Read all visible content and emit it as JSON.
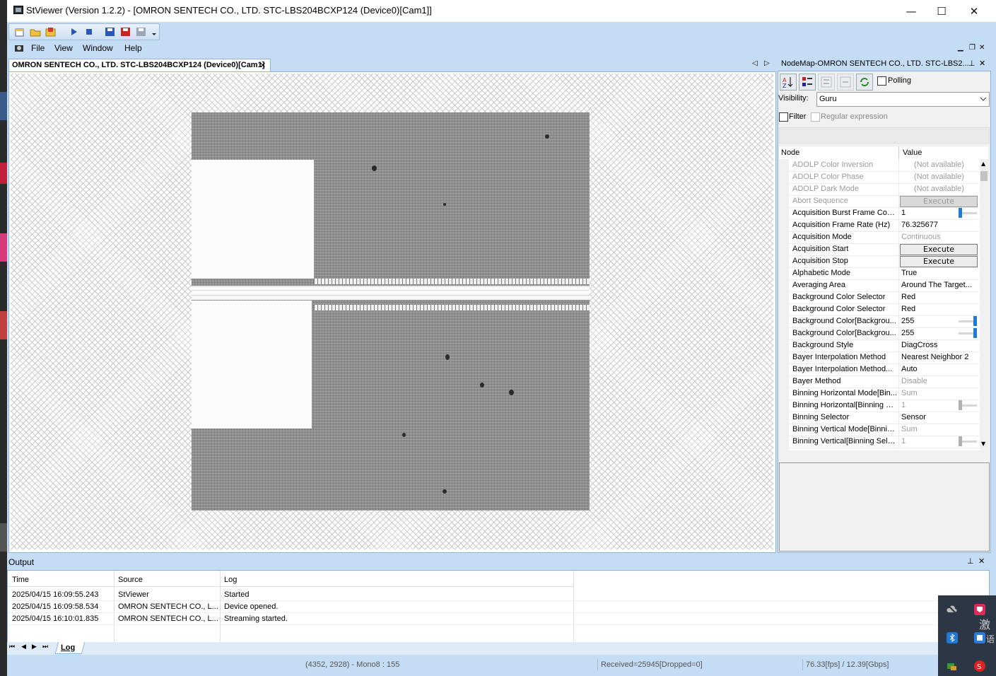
{
  "window": {
    "title": "StViewer (Version 1.2.2) - [OMRON SENTECH CO., LTD. STC-LBS204BCXP124 (Device0)[Cam1]]",
    "minimize_icon": "minimize-icon",
    "maximize_icon": "maximize-icon",
    "close_icon": "close-icon",
    "min_glyph": "—",
    "max_glyph": "☐",
    "close_glyph": "✕"
  },
  "menu": {
    "items": [
      "File",
      "View",
      "Window",
      "Help"
    ],
    "mdi_minimize": "▁",
    "mdi_restore": "❐",
    "mdi_close": "✕"
  },
  "document_tab": {
    "label": "OMRON SENTECH CO., LTD. STC-LBS204BCXP124 (Device0)[Cam1]",
    "close_glyph": "✕",
    "nav_left": "◁",
    "nav_right": "▷"
  },
  "nodemap": {
    "title": "NodeMap-OMRON SENTECH CO., LTD. STC-LBS2...",
    "pin_glyph": "⊥",
    "close_glyph": "✕",
    "polling_label": "Polling",
    "visibility_label": "Visibility:",
    "visibility_value": "Guru",
    "filter_label": "Filter",
    "regex_label": "Regular expression",
    "col_node": "Node",
    "col_value": "Value",
    "scroll_up": "▲",
    "scroll_down": "▼",
    "rows": [
      {
        "name": "ADOLP Color Inversion",
        "value": "(Not available)",
        "kind": "na"
      },
      {
        "name": "ADOLP Color Phase",
        "value": "(Not available)",
        "kind": "na"
      },
      {
        "name": "ADOLP Dark Mode",
        "value": "(Not available)",
        "kind": "na"
      },
      {
        "name": "Abort Sequence",
        "value": "Execute",
        "kind": "exec-disabled"
      },
      {
        "name": "Acquisition Burst Frame Count",
        "value": "1",
        "kind": "slider",
        "level": 0.0
      },
      {
        "name": "Acquisition Frame Rate (Hz)",
        "value": "76.325677",
        "kind": "text"
      },
      {
        "name": "Acquisition Mode",
        "value": "Continuous",
        "kind": "grey"
      },
      {
        "name": "Acquisition Start",
        "value": "Execute",
        "kind": "exec"
      },
      {
        "name": "Acquisition Stop",
        "value": "Execute",
        "kind": "exec"
      },
      {
        "name": "Alphabetic Mode",
        "value": "True",
        "kind": "text"
      },
      {
        "name": "Averaging Area",
        "value": "Around The Target...",
        "kind": "text"
      },
      {
        "name": "Background Color Selector",
        "value": "Red",
        "kind": "text"
      },
      {
        "name": "Background Color Selector",
        "value": "Red",
        "kind": "text"
      },
      {
        "name": "Background Color[Backgrou...",
        "value": "255",
        "kind": "slider",
        "level": 1.0
      },
      {
        "name": "Background Color[Backgrou...",
        "value": "255",
        "kind": "slider",
        "level": 1.0
      },
      {
        "name": "Background Style",
        "value": "DiagCross",
        "kind": "text"
      },
      {
        "name": "Bayer Interpolation Method",
        "value": "Nearest Neighbor 2",
        "kind": "text"
      },
      {
        "name": "Bayer Interpolation Method...",
        "value": "Auto",
        "kind": "text"
      },
      {
        "name": "Bayer Method",
        "value": "Disable",
        "kind": "grey"
      },
      {
        "name": "Binning Horizontal Mode[Bin...",
        "value": "Sum",
        "kind": "grey"
      },
      {
        "name": "Binning Horizontal[Binning S...",
        "value": "1",
        "kind": "slider-grey",
        "level": 0.0
      },
      {
        "name": "Binning Selector",
        "value": "Sensor",
        "kind": "text"
      },
      {
        "name": "Binning Vertical Mode[Binnin...",
        "value": "Sum",
        "kind": "grey"
      },
      {
        "name": "Binning Vertical[Binning Sele...",
        "value": "1",
        "kind": "slider-grey",
        "level": 0.0
      }
    ]
  },
  "output": {
    "title": "Output",
    "columns": [
      "Time",
      "Source",
      "Log"
    ],
    "rows": [
      [
        "2025/04/15 16:09:55.243",
        "StViewer",
        "Started"
      ],
      [
        "2025/04/15 16:09:58.534",
        "OMRON SENTECH CO., L...",
        "Device opened."
      ],
      [
        "2025/04/15 16:10:01.835",
        "OMRON SENTECH CO., L...",
        "Streaming started."
      ]
    ],
    "tab_label": "Log",
    "nav": [
      "⏮",
      "◀",
      "▶",
      "⏭"
    ]
  },
  "status": {
    "pixel_info": "(4352, 2928) - Mono8 : 155",
    "received": "Received=25945[Dropped=0]",
    "rate": "76.33[fps] / 12.39[Gbps]"
  },
  "tray": {
    "text1": "激",
    "text2": "语"
  },
  "colors": {
    "chrome": "#c5dcf5",
    "accent": "#1f7bd6"
  }
}
